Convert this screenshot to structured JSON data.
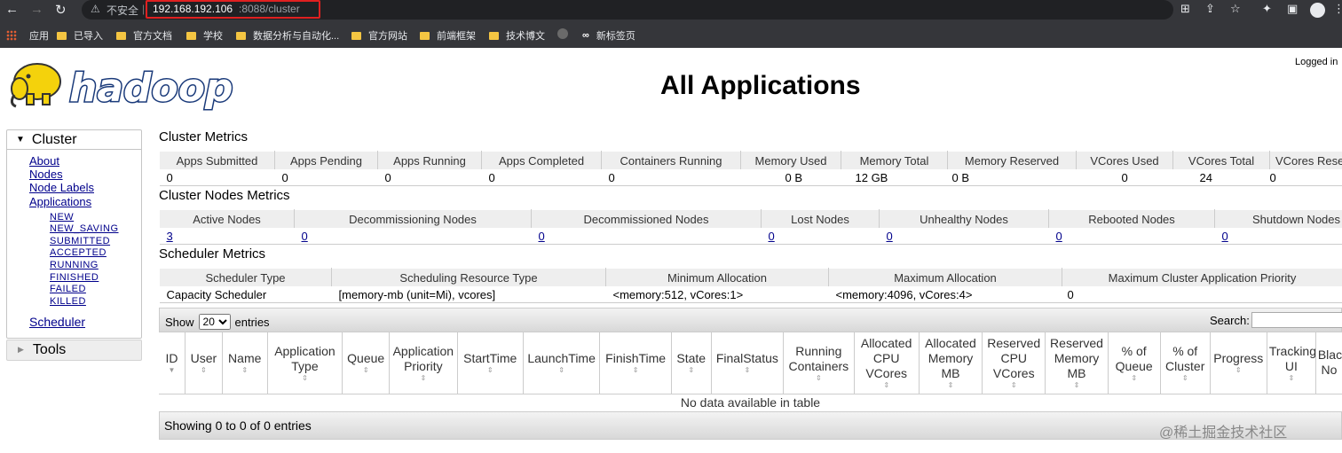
{
  "browser": {
    "insecure_label": "不安全",
    "url_host": "192.168.192.106",
    "url_path": ":8088/cluster",
    "bookmarks": [
      "应用",
      "已导入",
      "官方文档",
      "学校",
      "数据分析与自动化...",
      "官方网站",
      "前端框架",
      "技术博文",
      "新标签页"
    ]
  },
  "header": {
    "logo_text": "hadoop",
    "title": "All Applications",
    "logged_in": "Logged in"
  },
  "sidebar": {
    "cluster_label": "Cluster",
    "links": [
      "About",
      "Nodes",
      "Node Labels",
      "Applications"
    ],
    "app_states": [
      "NEW",
      "NEW_SAVING",
      "SUBMITTED",
      "ACCEPTED",
      "RUNNING",
      "FINISHED",
      "FAILED",
      "KILLED"
    ],
    "scheduler": "Scheduler",
    "tools_label": "Tools"
  },
  "cluster_metrics": {
    "title": "Cluster Metrics",
    "headers": [
      "Apps Submitted",
      "Apps Pending",
      "Apps Running",
      "Apps Completed",
      "Containers Running",
      "Memory Used",
      "Memory Total",
      "Memory Reserved",
      "VCores Used",
      "VCores Total",
      "VCores Rese"
    ],
    "values": [
      "0",
      "0",
      "0",
      "0",
      "0",
      "0 B",
      "12 GB",
      "0 B",
      "0",
      "24",
      "0"
    ]
  },
  "nodes_metrics": {
    "title": "Cluster Nodes Metrics",
    "headers": [
      "Active Nodes",
      "Decommissioning Nodes",
      "Decommissioned Nodes",
      "Lost Nodes",
      "Unhealthy Nodes",
      "Rebooted Nodes",
      "Shutdown Nodes"
    ],
    "values": [
      "3",
      "0",
      "0",
      "0",
      "0",
      "0",
      "0"
    ]
  },
  "scheduler_metrics": {
    "title": "Scheduler Metrics",
    "headers": [
      "Scheduler Type",
      "Scheduling Resource Type",
      "Minimum Allocation",
      "Maximum Allocation",
      "Maximum Cluster Application Priority"
    ],
    "values": [
      "Capacity Scheduler",
      "[memory-mb (unit=Mi), vcores]",
      "<memory:512, vCores:1>",
      "<memory:4096, vCores:4>",
      "0"
    ]
  },
  "apps_table": {
    "show_label": "Show",
    "page_size": "20",
    "entries_label": "entries",
    "search_label": "Search:",
    "columns": [
      "ID",
      "User",
      "Name",
      "Application Type",
      "Queue",
      "Application Priority",
      "StartTime",
      "LaunchTime",
      "FinishTime",
      "State",
      "FinalStatus",
      "Running Containers",
      "Allocated CPU VCores",
      "Allocated Memory MB",
      "Reserved CPU VCores",
      "Reserved Memory MB",
      "% of Queue",
      "% of Cluster",
      "Progress",
      "Tracking UI",
      "Blac No"
    ],
    "empty_message": "No data available in table",
    "info": "Showing 0 to 0 of 0 entries"
  },
  "watermark": "@稀土掘金技术社区"
}
